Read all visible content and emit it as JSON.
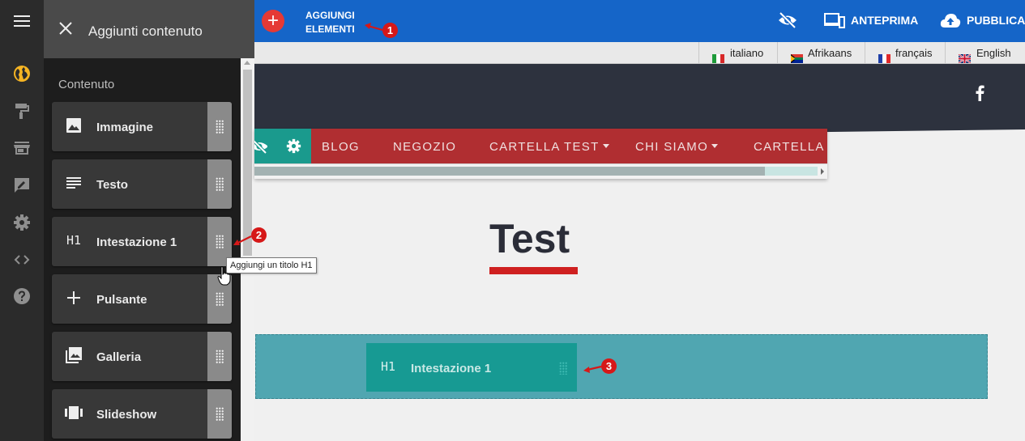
{
  "panel": {
    "title": "Aggiunti contenuto",
    "section": "Contenuto",
    "items": [
      {
        "label": "Immagine",
        "icon": "image-icon"
      },
      {
        "label": "Testo",
        "icon": "text-icon"
      },
      {
        "label": "Intestazione 1",
        "icon": "h1-icon",
        "icon_text": "H1"
      },
      {
        "label": "Pulsante",
        "icon": "plus-icon"
      },
      {
        "label": "Galleria",
        "icon": "gallery-icon"
      },
      {
        "label": "Slideshow",
        "icon": "slideshow-icon"
      }
    ]
  },
  "rail": {
    "icons": [
      "globe-icon",
      "paint-roller-icon",
      "store-icon",
      "edit-post-icon",
      "gear-icon",
      "code-icon",
      "help-icon"
    ],
    "active_color": "#f5b423"
  },
  "toolbar": {
    "add_label": "AGGIUNGI ELEMENTI",
    "preview_label": "ANTEPRIMA",
    "publish_label": "PUBBLICA",
    "accent": "#1565c8"
  },
  "languages": [
    {
      "label": "italiano",
      "flag": "it"
    },
    {
      "label": "Afrikaans",
      "flag": "za"
    },
    {
      "label": "français",
      "flag": "fr"
    },
    {
      "label": "English",
      "flag": "gb"
    }
  ],
  "site": {
    "nav": [
      {
        "label": "BLOG",
        "dropdown": false
      },
      {
        "label": "NEGOZIO",
        "dropdown": false
      },
      {
        "label": "CARTELLA TEST",
        "dropdown": true
      },
      {
        "label": "CHI SIAMO",
        "dropdown": true
      },
      {
        "label": "CARTELLA T",
        "dropdown": false
      }
    ],
    "heading": "Test",
    "nav_color": "#b02e31"
  },
  "tooltip": "Aggiungi un titolo H1",
  "drag_ghost": {
    "icon_text": "H1",
    "label": "Intestazione 1"
  },
  "annotations": [
    "1",
    "2",
    "3"
  ],
  "annotation_color": "#d61818"
}
